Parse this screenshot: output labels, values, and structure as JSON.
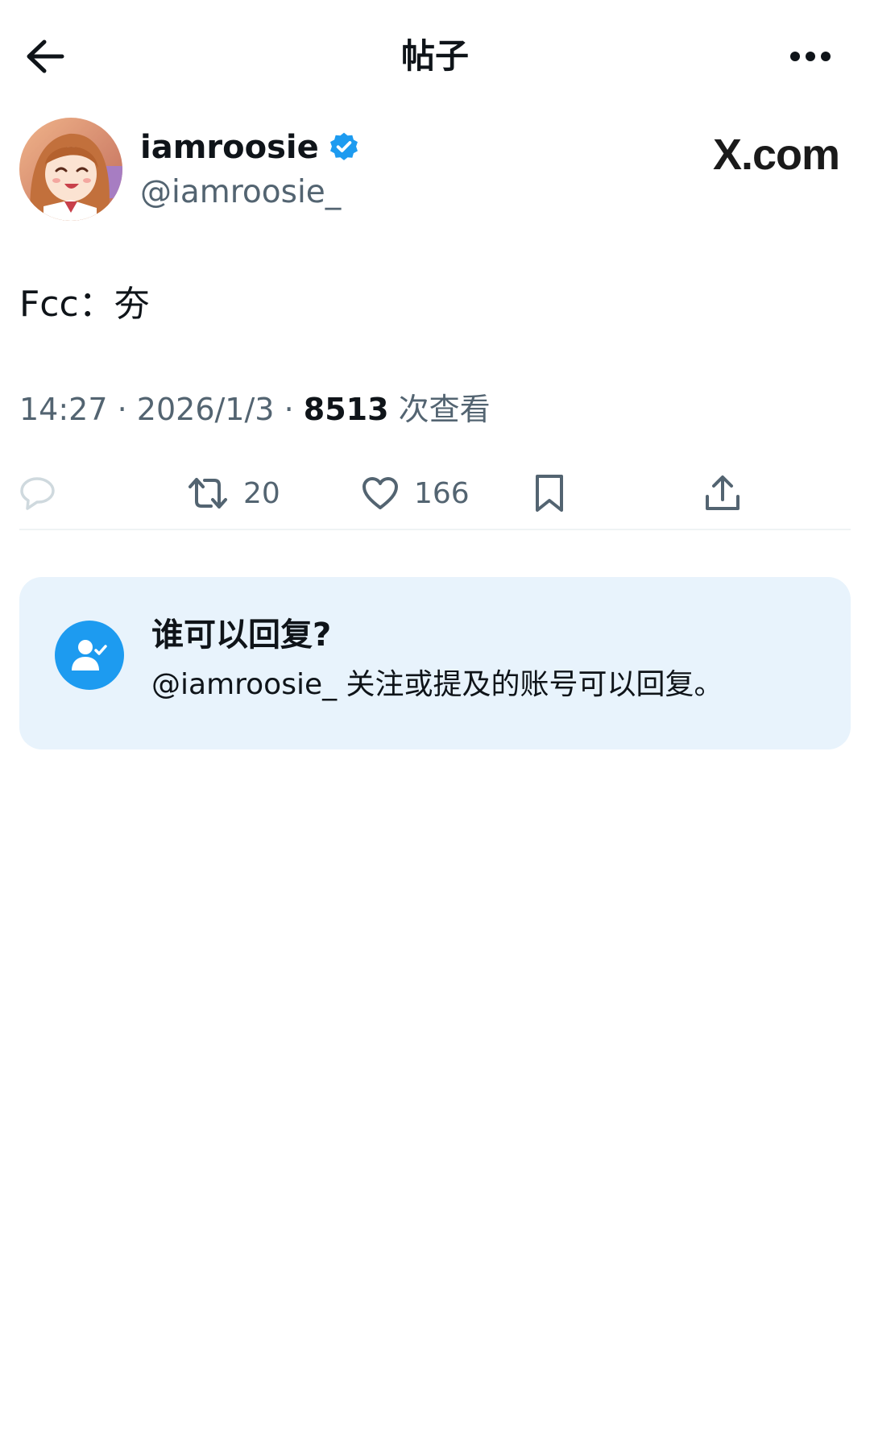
{
  "header": {
    "title": "帖子",
    "back_icon": "arrow-left-icon",
    "more_icon": "more-horizontal-icon"
  },
  "author": {
    "display_name": "iamroosie",
    "handle": "@iamroosie_",
    "verified": true,
    "verified_color": "#1d9bf0"
  },
  "watermark": {
    "text": "X.com"
  },
  "post": {
    "text": "Fcc：夯"
  },
  "meta": {
    "time": "14:27",
    "date": "2026/1/3",
    "separator": "·",
    "views_count": "8513",
    "views_label": "次查看"
  },
  "actions": {
    "reply": {
      "icon": "reply-icon",
      "count": ""
    },
    "retweet": {
      "icon": "retweet-icon",
      "count": "20"
    },
    "like": {
      "icon": "heart-icon",
      "count": "166"
    },
    "bookmark": {
      "icon": "bookmark-icon"
    },
    "share": {
      "icon": "share-icon"
    }
  },
  "reply_restriction": {
    "icon": "user-check-icon",
    "title": "谁可以回复?",
    "description": "@iamroosie_ 关注或提及的账号可以回复。",
    "card_color": "#e8f3fc",
    "icon_color": "#1d9bf0"
  }
}
